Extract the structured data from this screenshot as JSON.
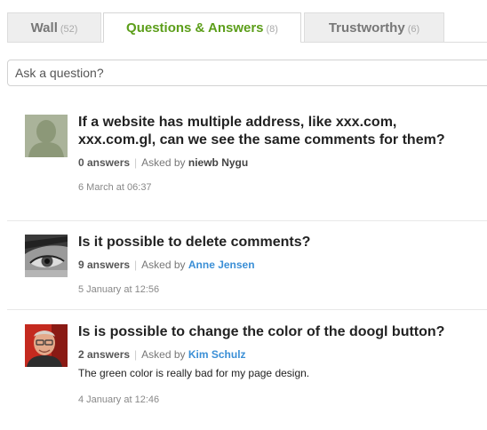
{
  "tabs": [
    {
      "label": "Wall",
      "count": "(52)"
    },
    {
      "label": "Questions & Answers",
      "count": "(8)"
    },
    {
      "label": "Trustworthy",
      "count": "(6)"
    }
  ],
  "ask": {
    "placeholder": "Ask a question?"
  },
  "questions": [
    {
      "title": "If a website has multiple address, like xxx.com, xxx.com.gl, can we see the same comments for them?",
      "answers": "0 answers",
      "asked_by_label": "Asked by",
      "author": "niewb Nygu",
      "description": "",
      "date": "6 March at 06:37"
    },
    {
      "title": "Is it possible to delete comments?",
      "answers": "9 answers",
      "asked_by_label": "Asked by",
      "author": "Anne Jensen",
      "description": "",
      "date": "5 January at 12:56"
    },
    {
      "title": "Is is possible to change the color of the doogl button?",
      "answers": "2 answers",
      "asked_by_label": "Asked by",
      "author": "Kim Schulz",
      "description": "The green color is really bad for my page design.",
      "date": "4 January at 12:46"
    }
  ],
  "colors": {
    "active_tab": "#5c9e1a",
    "author_link": "#3b8fd6"
  }
}
